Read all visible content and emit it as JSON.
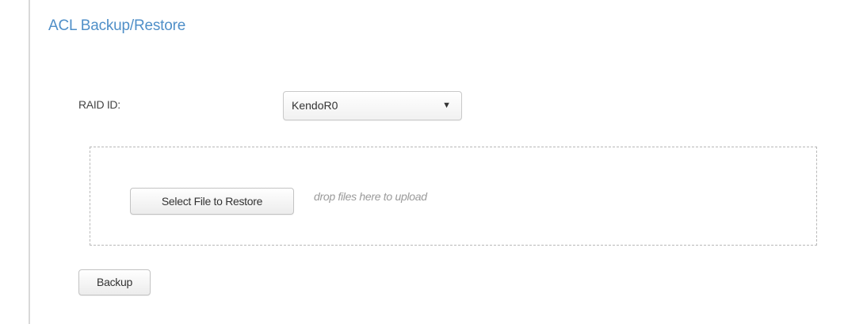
{
  "page": {
    "title": "ACL Backup/Restore"
  },
  "form": {
    "raid_label": "RAID ID:",
    "raid_select": {
      "selected": "KendoR0",
      "arrow_icon": "triangle-down-icon"
    }
  },
  "upload": {
    "select_button_label": "Select File to Restore",
    "drop_hint": "drop files here to upload"
  },
  "actions": {
    "backup_label": "Backup"
  },
  "colors": {
    "title": "#4f8fc8",
    "text": "#444444",
    "hint": "#9a9a9a"
  }
}
